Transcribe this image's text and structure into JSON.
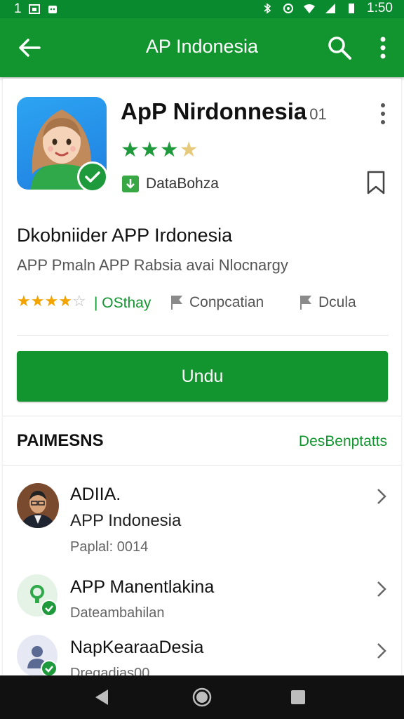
{
  "status_bar": {
    "left_text": "1",
    "time": "1:50"
  },
  "app_bar": {
    "title": "AP Indonesia"
  },
  "app": {
    "name": "ApP Nirdonnesia",
    "version": "01",
    "star_rating": 3.5,
    "developer": "DataBohza"
  },
  "headline": "Dkobniider APP Irdonesia",
  "subline": "APP Pmaln APP Rabsia avai Nlocnargy",
  "meta": {
    "rating_stars": 4.5,
    "rating_text": "| OSthay",
    "tag1": "Conpcatian",
    "tag2": "Dcula"
  },
  "install_label": "Undu",
  "section": {
    "title": "PAIMESNS",
    "link": "DesBenptatts"
  },
  "list": [
    {
      "title": "ADIIA.",
      "subtitle": "APP Indonesia",
      "meta": "Paplal: 0014"
    },
    {
      "title": "APP Manentlakina",
      "meta": "Dateambahilan"
    },
    {
      "title": "NapKearaaDesia",
      "meta": "Dregadias00"
    }
  ],
  "colors": {
    "primary_green": "#12952f",
    "status_green": "#0a8a2e",
    "star_gold": "#f2a300"
  },
  "icons": [
    "back-arrow-icon",
    "search-icon",
    "more-vert-icon",
    "verified-check-icon",
    "bookmark-icon",
    "flag-icon",
    "chevron-right-icon",
    "nav-back-icon",
    "nav-home-icon",
    "nav-recents-icon"
  ]
}
